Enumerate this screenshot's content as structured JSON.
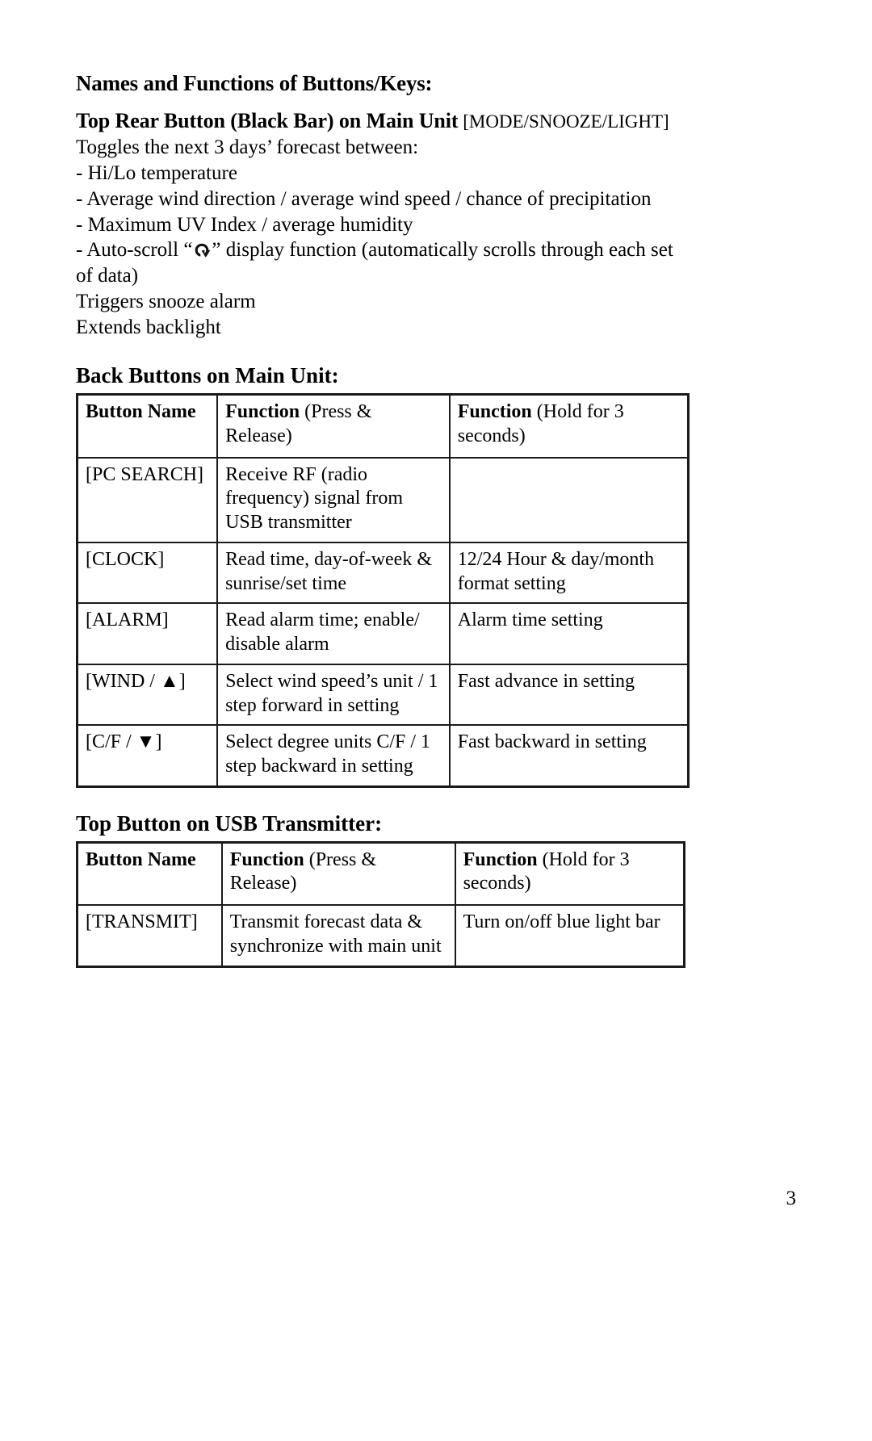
{
  "page": {
    "number": "3"
  },
  "headings": {
    "main_title": "Names and Functions of Buttons/Keys:",
    "top_rear_button_bold": "Top Rear Button (Black Bar) on Main Unit",
    "top_rear_button_codes": "[MODE/SNOOZE/LIGHT]",
    "back_buttons": "Back Buttons on Main Unit:",
    "usb_transmitter": "Top Button on USB Transmitter:"
  },
  "top_rear_button": {
    "intro": "Toggles the next 3 days’ forecast between:",
    "bullets": [
      "- Hi/Lo temperature",
      "- Average wind direction / average wind speed / chance of precipitation",
      "- Maximum UV Index / average humidity"
    ],
    "autoscroll_prefix": "- Auto-scroll “",
    "autoscroll_icon": "auto-scroll-circular-arrow-icon",
    "autoscroll_suffix": "” display function (automatically scrolls through each set of data)",
    "extra_lines": [
      "Triggers snooze alarm",
      "Extends backlight"
    ]
  },
  "table_back_buttons": {
    "headers": {
      "col1": "Button Name",
      "col2_bold": "Function",
      "col2_paren": " (Press & Release)",
      "col3_bold": "Function",
      "col3_paren": " (Hold for 3 seconds)"
    },
    "rows": [
      {
        "button": "[PC SEARCH]",
        "press_release": "Receive RF (radio frequency) signal from USB transmitter",
        "hold": ""
      },
      {
        "button": "[CLOCK]",
        "press_release": "Read time, day-of-week & sunrise/set time",
        "hold": "12/24 Hour & day/month format setting"
      },
      {
        "button": "[ALARM]",
        "press_release": "Read alarm time; enable/ disable alarm",
        "hold": "Alarm time setting"
      },
      {
        "button": "[WIND / ▲]",
        "press_release": "Select wind speed’s unit / 1 step forward in setting",
        "hold": "Fast advance in setting"
      },
      {
        "button": "[C/F / ▼]",
        "press_release": "Select degree units C/F / 1 step backward in setting",
        "hold": "Fast backward in setting"
      }
    ]
  },
  "table_usb": {
    "headers": {
      "col1": "Button Name",
      "col2_bold": "Function",
      "col2_paren": " (Press & Release)",
      "col3_bold": "Function",
      "col3_paren": " (Hold for 3 seconds)"
    },
    "rows": [
      {
        "button": "[TRANSMIT]",
        "press_release": "Transmit forecast data & synchronize with main unit",
        "hold": "Turn on/off blue light bar"
      }
    ]
  },
  "colors": {
    "text": "#000000",
    "border": "#1a1a1a",
    "background": "#ffffff"
  }
}
